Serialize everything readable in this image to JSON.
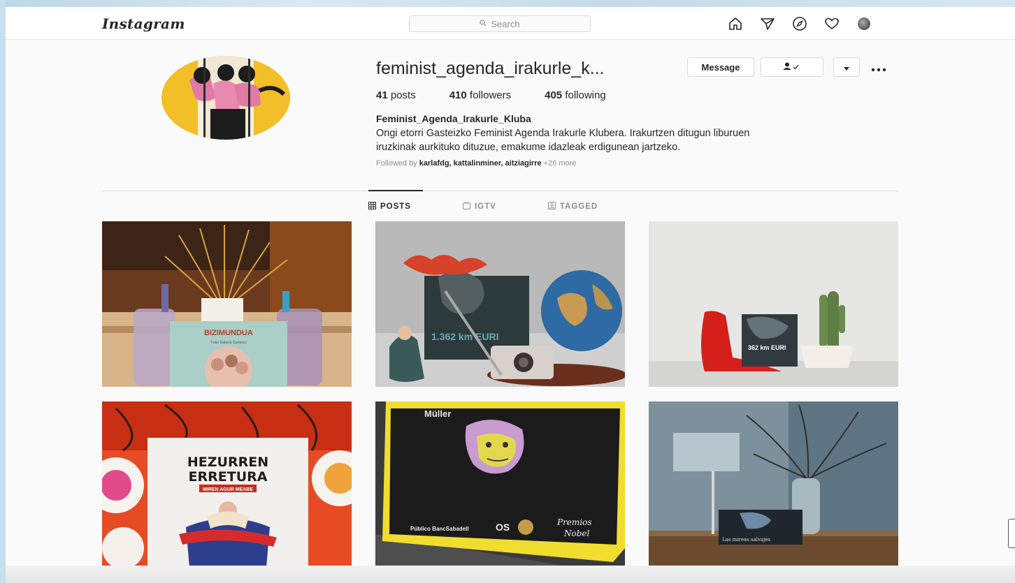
{
  "header": {
    "logo": "Instagram",
    "search_placeholder": "Search",
    "nav_icons": [
      "home-icon",
      "direct-icon",
      "explore-icon",
      "activity-icon",
      "profile-avatar"
    ]
  },
  "profile": {
    "username": "feminist_agenda_irakurle_k...",
    "message_button": "Message",
    "stats": {
      "posts_count": "41",
      "posts_label": "posts",
      "followers_count": "410",
      "followers_label": "followers",
      "following_count": "405",
      "following_label": "following"
    },
    "full_name": "Feminist_Agenda_Irakurle_Kluba",
    "bio_line1": "Ongi etorri Gasteizko Feminist Agenda Irakurle Klubera. Irakurtzen ditugun liburuen",
    "bio_line2": "iruzkinak aurkituko dituzue, emakume idazleak erdigunean jartzeko.",
    "followed_by_prefix": "Followed by ",
    "followed_by_names": "karlafdg, kattalinminer, aitziagirre",
    "followed_by_more": " +26 more"
  },
  "tabs": [
    {
      "label": "POSTS",
      "icon": "grid-icon",
      "active": true
    },
    {
      "label": "IGTV",
      "icon": "igtv-icon",
      "active": false
    },
    {
      "label": "TAGGED",
      "icon": "tagged-icon",
      "active": false
    }
  ],
  "posts": {
    "post1_book_title": "BIZIMUNDUA",
    "post1_book_subtitle": "Txilar Galarra Carrasco",
    "post2_book_title": "1.362 km EURI",
    "post3_book_title": "362 km EURI",
    "post4_book_title_line1": "HEZURREN",
    "post4_book_title_line2": "ERRETURA",
    "post4_book_author": "MIREN AGUR MEABE",
    "post5_brand_top": "Müller",
    "post5_sponsor": "Público BancSabadell",
    "post5_prize_mark": "OS",
    "post5_prize_line1": "Premios",
    "post5_prize_line2": "Nobel",
    "post6_book_title": "Las mireas salvajes"
  },
  "colors": {
    "accent_text": "#262626",
    "muted_text": "#8e8e8e",
    "border": "#dbdbdb",
    "page_bg": "#fafafa"
  }
}
